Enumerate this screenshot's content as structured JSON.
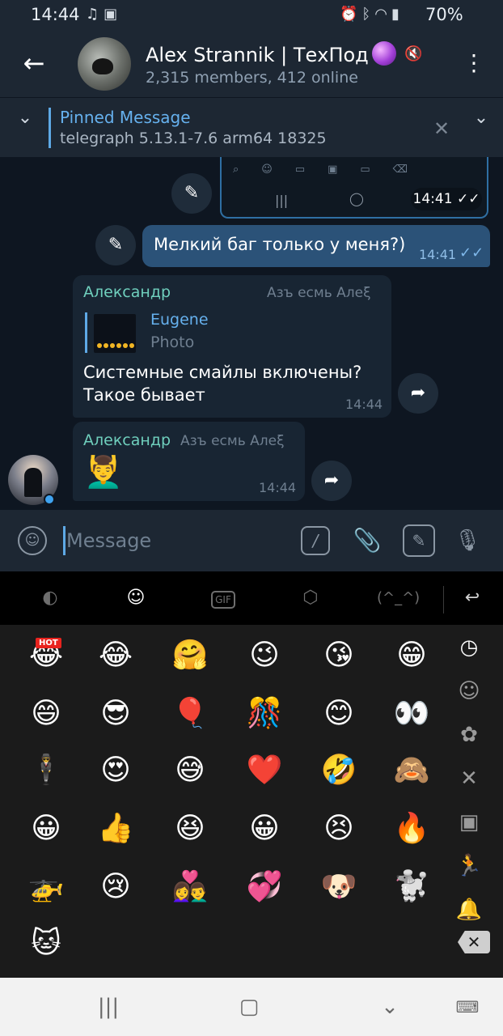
{
  "status_bar": {
    "time": "14:44",
    "left_icons": [
      "music-note",
      "image"
    ],
    "right_icons": [
      "alarm",
      "bluetooth",
      "wifi",
      "signal"
    ],
    "battery": "70%"
  },
  "header": {
    "title": "Alex Strannik | ТехПод",
    "subtitle": "2,315 members, 412 online"
  },
  "pinned": {
    "title": "Pinned Message",
    "text": "telegraph 5.13.1-7.6 arm64 18325"
  },
  "messages": [
    {
      "type": "outgoing-image-partial",
      "time": "14:41"
    },
    {
      "type": "outgoing",
      "text": "Мелкий баг только у меня?)",
      "time": "14:41"
    },
    {
      "type": "incoming",
      "sender": "Александр",
      "signature": "Азъ есмь Алеξ",
      "reply": {
        "name": "Eugene",
        "type": "Photo"
      },
      "text_lines": [
        "Системные смайлы включены?",
        "Такое бывает"
      ],
      "time": "14:44"
    },
    {
      "type": "incoming",
      "sender": "Александр",
      "signature": "Азъ есмь Алеξ",
      "emoji": "💆‍♂️",
      "time": "14:44"
    }
  ],
  "composer": {
    "placeholder": "Message",
    "value": "",
    "command_symbol": "/"
  },
  "keyboard_tabs": [
    "emoji-search",
    "emoji",
    "GIF",
    "sticker",
    "(^_^)",
    "hide-keyboard"
  ],
  "emoji_grid": [
    [
      "😂",
      "😂",
      "🤗",
      "😉",
      "😘",
      "😁"
    ],
    [
      "😄",
      "😎",
      "🎈",
      "🎊",
      "😊",
      "👀"
    ],
    [
      "🕴",
      "😍",
      "😅",
      "❤️",
      "🤣",
      "🙈"
    ],
    [
      "😀",
      "👍",
      "😆",
      "😀",
      "😣",
      "🔥"
    ],
    [
      "🚁",
      "😢",
      "👩‍❤️‍👨",
      "💞",
      "🐶",
      "🐩"
    ],
    [
      "🐱"
    ]
  ],
  "hot_badge": "HOT",
  "emoji_categories": [
    "recent",
    "smileys",
    "nature",
    "food",
    "travel",
    "activity",
    "objects"
  ],
  "nav_bar": [
    "recent-apps",
    "home",
    "back",
    "keyboard"
  ],
  "colors": {
    "background": "#0e1621",
    "header": "#1d2733",
    "outgoing_bubble": "#2b5278",
    "incoming_bubble": "#182533",
    "accent": "#5ea9e6",
    "sender_name": "#6fcfbd"
  }
}
